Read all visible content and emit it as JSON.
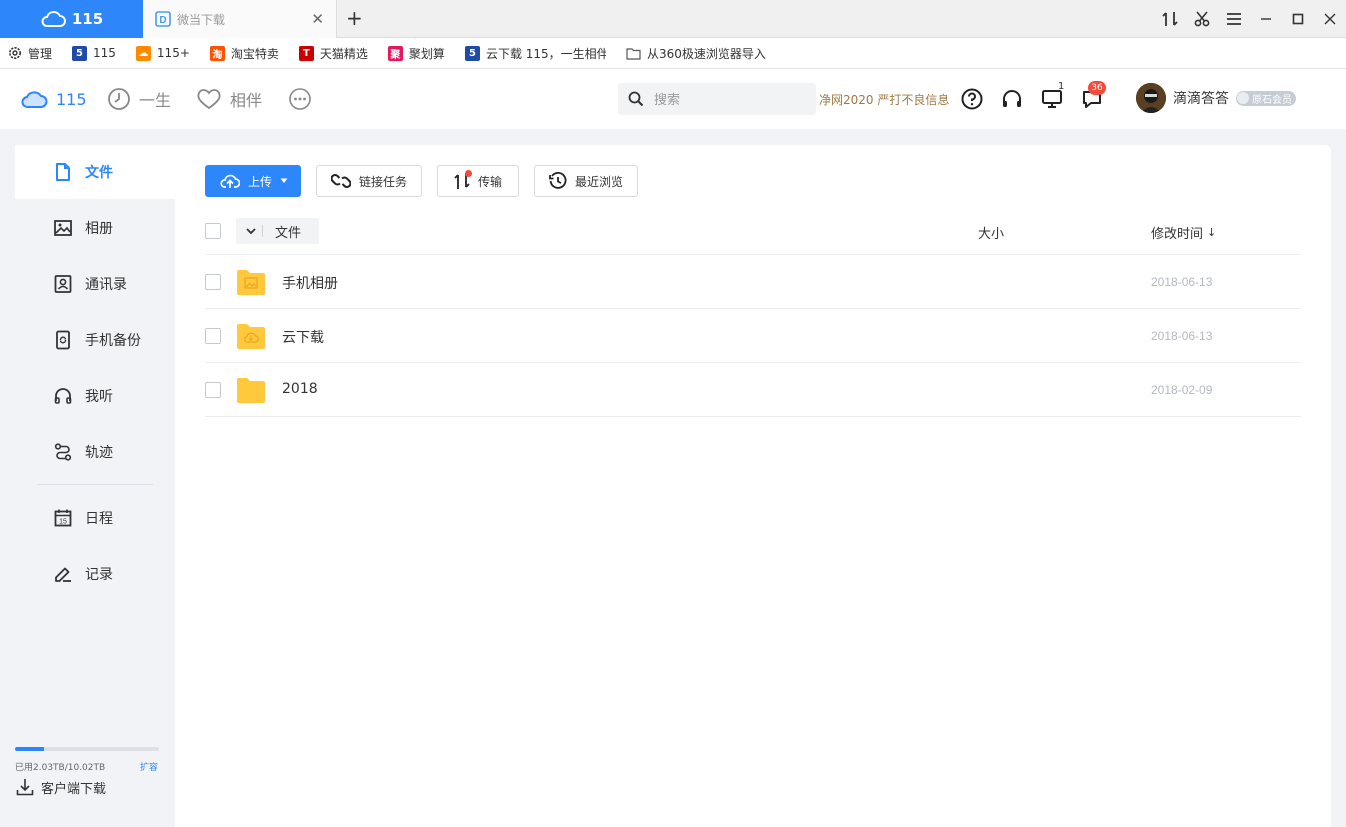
{
  "browser": {
    "active_tab": {
      "label": "115",
      "icon": "cloud-icon"
    },
    "inactive_tab": {
      "label": "微当下载",
      "icon": "weidown-icon"
    },
    "new_tab": "+",
    "window_controls": [
      "transfer-icon",
      "scissors-icon",
      "menu-icon",
      "minimize-icon",
      "maximize-icon",
      "close-icon"
    ]
  },
  "bookmarks": [
    {
      "label": "管理",
      "icon": "gear-icon"
    },
    {
      "label": "115",
      "icon": "115-s-icon",
      "color": "#1f4aa8",
      "glyph": "5"
    },
    {
      "label": "115+",
      "icon": "cloud-orange-icon",
      "color": "#ff8a00",
      "glyph": "☁"
    },
    {
      "label": "淘宝特卖",
      "icon": "taobao-icon",
      "color": "#ff5000",
      "glyph": "淘"
    },
    {
      "label": "天猫精选",
      "icon": "tmall-icon",
      "color": "#cc0000",
      "glyph": "T"
    },
    {
      "label": "聚划算",
      "icon": "juhuasuan-icon",
      "color": "#e8175d",
      "glyph": "聚"
    },
    {
      "label": "云下载 115，一生相伴",
      "icon": "115-s-icon",
      "color": "#1f4aa8",
      "glyph": "5"
    },
    {
      "label": "从360极速浏览器导入",
      "icon": "folder-outline-icon"
    }
  ],
  "header": {
    "nav": [
      {
        "label": "115",
        "icon": "cloud-icon"
      },
      {
        "label": "一生",
        "icon": "clock-icon"
      },
      {
        "label": "相伴",
        "icon": "heart-icon"
      },
      {
        "label": "",
        "icon": "more-icon"
      }
    ],
    "search_placeholder": "搜索",
    "notice": "净网2020 严打不良信息",
    "device_badge": "1",
    "message_badge": "36",
    "username": "滴滴答答",
    "member_label": "原石会员"
  },
  "sidebar": {
    "items": [
      {
        "label": "文件",
        "icon": "file-icon",
        "active": true
      },
      {
        "label": "相册",
        "icon": "image-icon"
      },
      {
        "label": "通讯录",
        "icon": "contact-icon"
      },
      {
        "label": "手机备份",
        "icon": "phone-backup-icon"
      },
      {
        "label": "我听",
        "icon": "headphones-icon"
      },
      {
        "label": "轨迹",
        "icon": "track-icon"
      },
      {
        "label": "日程",
        "icon": "calendar-icon"
      },
      {
        "label": "记录",
        "icon": "edit-icon"
      }
    ],
    "storage_text": "已用2.03TB/10.02TB",
    "storage_used_fraction": 0.2026,
    "expand_label": "扩容",
    "client_download": "客户端下载",
    "calendar_day": "15"
  },
  "toolbar": {
    "upload": "上传",
    "link_task": "链接任务",
    "transfer": "传输",
    "recent": "最近浏览"
  },
  "table": {
    "header_file": "文件",
    "header_size": "大小",
    "header_mtime": "修改时间",
    "sort_arrow": "↓",
    "rows": [
      {
        "name": "手机相册",
        "size": "",
        "date": "2018-06-13",
        "icon": "folder-photo-icon"
      },
      {
        "name": "云下载",
        "size": "",
        "date": "2018-06-13",
        "icon": "folder-cloud-icon"
      },
      {
        "name": "2018",
        "size": "",
        "date": "2018-02-09",
        "icon": "folder-icon"
      }
    ]
  },
  "colors": {
    "accent": "#2e86fb",
    "folder": "#ffc83d",
    "badge": "#f24a3c",
    "notice": "#a07a44"
  }
}
